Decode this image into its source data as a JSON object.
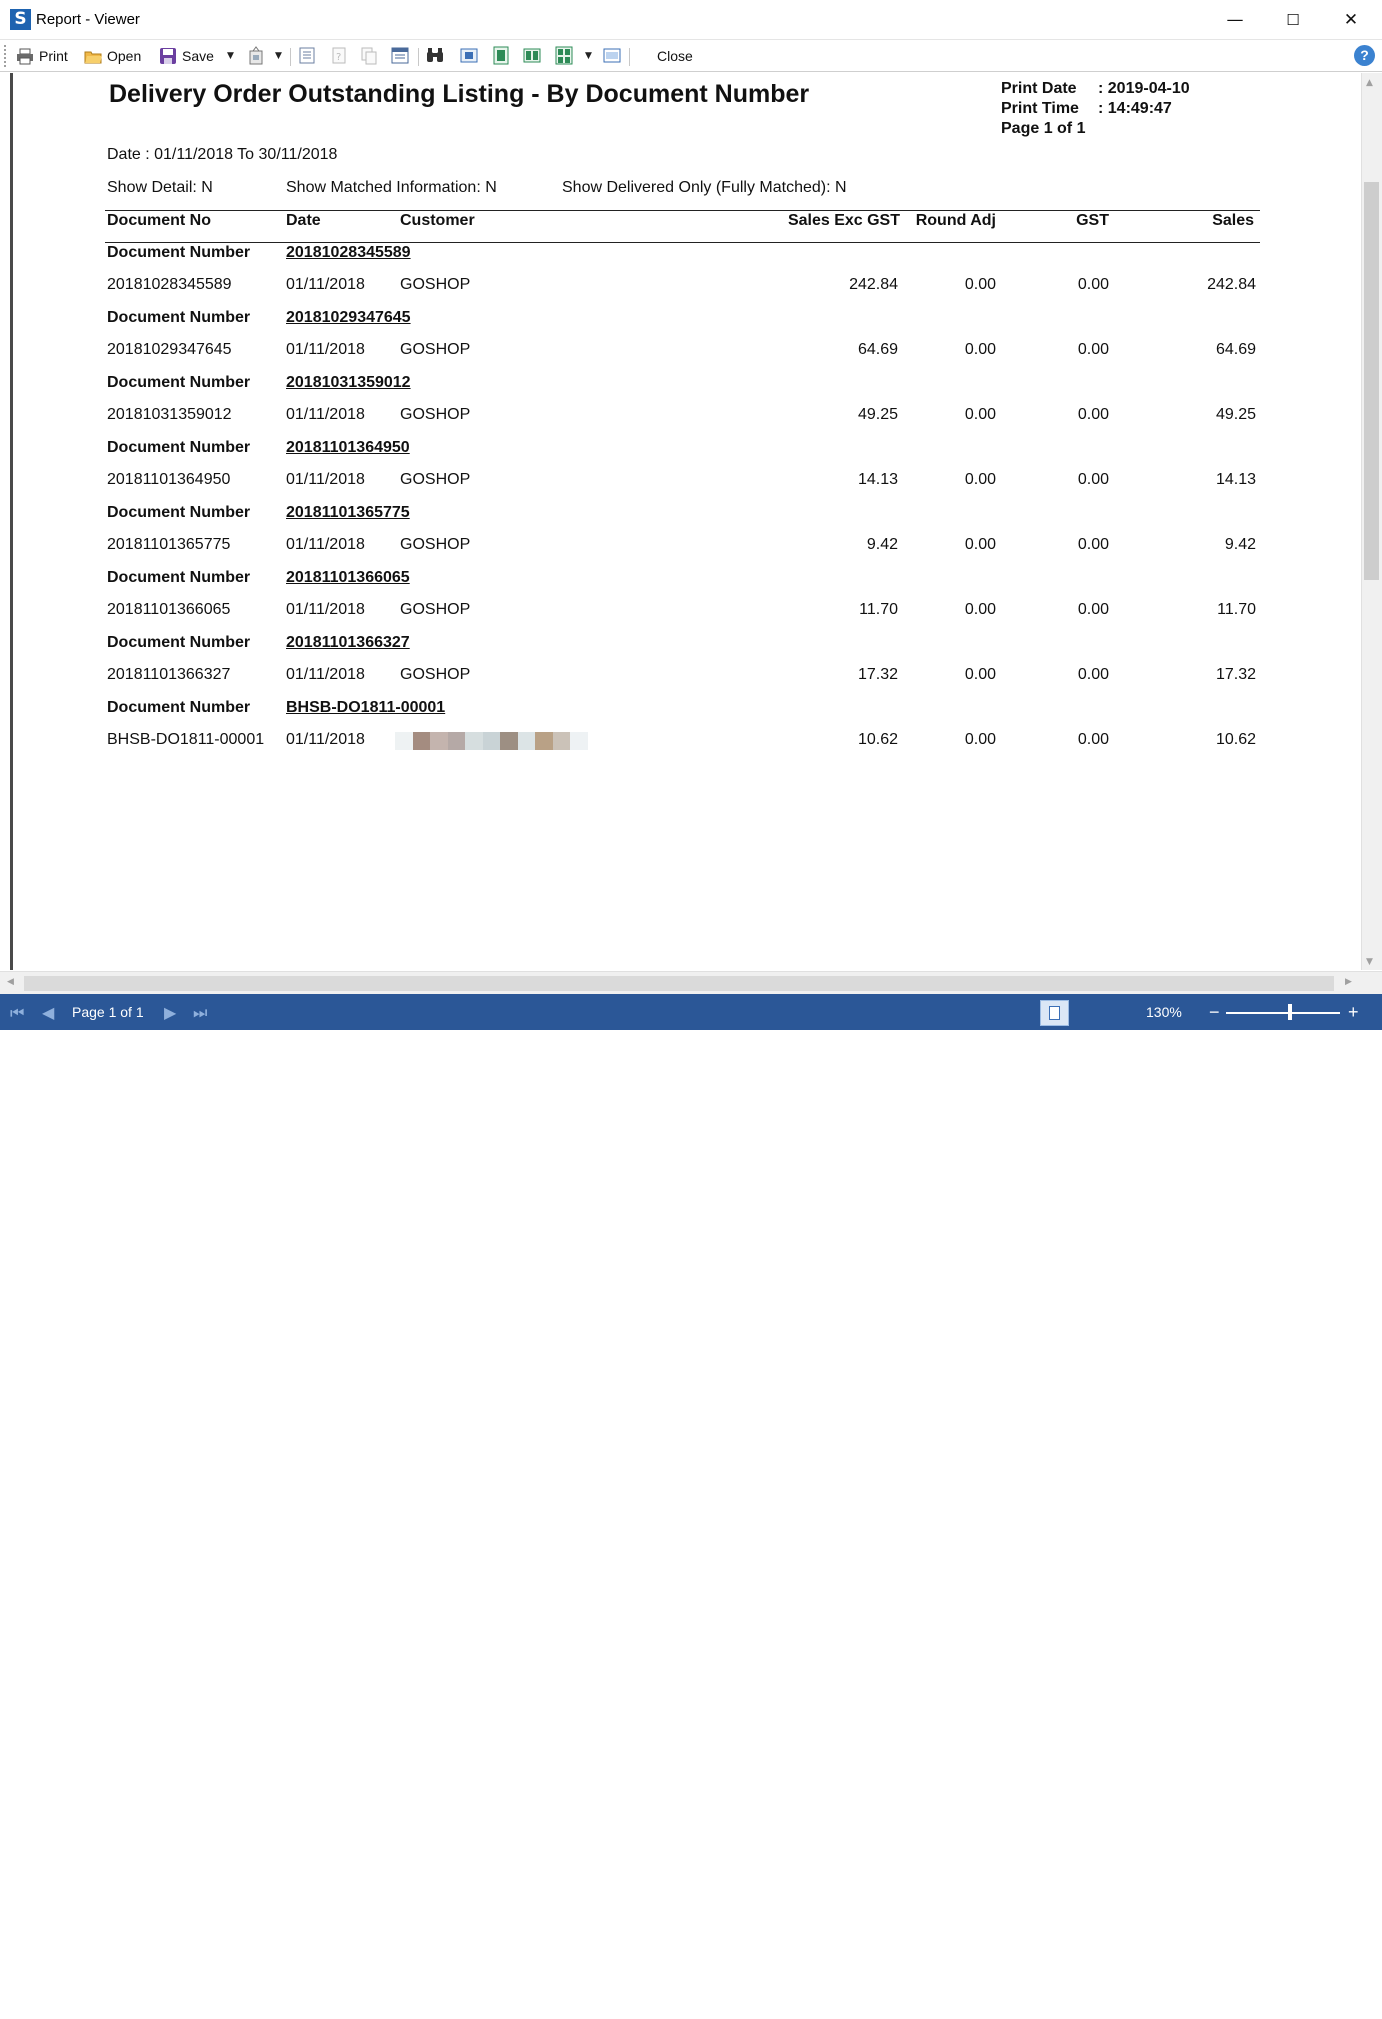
{
  "window": {
    "title": "Report - Viewer",
    "minimize": "—",
    "maximize": "☐",
    "close": "✕"
  },
  "toolbar": {
    "print_label": "Print",
    "open_label": "Open",
    "save_label": "Save",
    "close_label": "Close",
    "help_label": "?"
  },
  "report": {
    "title": "Delivery Order Outstanding Listing - By Document Number",
    "print_date_label": "Print Date",
    "print_date": ": 2019-04-10",
    "print_time_label": "Print Time",
    "print_time": ": 14:49:47",
    "page_info": "Page 1 of 1",
    "date_range": "Date : 01/11/2018 To 30/11/2018",
    "show_detail": "Show Detail: N",
    "show_matched": "Show Matched Information: N",
    "show_delivered": "Show Delivered Only (Fully Matched): N",
    "columns": {
      "doc_no": "Document No",
      "date": "Date",
      "customer": "Customer",
      "sales_exc_gst": "Sales Exc GST",
      "round_adj": "Round Adj",
      "gst": "GST",
      "sales": "Sales"
    },
    "group_label": "Document Number",
    "rows": [
      {
        "group": "20181028345589",
        "doc_no": "20181028345589",
        "date": "01/11/2018",
        "customer": "GOSHOP",
        "sales_exc_gst": "242.84",
        "round_adj": "0.00",
        "gst": "0.00",
        "sales": "242.84"
      },
      {
        "group": "20181029347645",
        "doc_no": "20181029347645",
        "date": "01/11/2018",
        "customer": "GOSHOP",
        "sales_exc_gst": "64.69",
        "round_adj": "0.00",
        "gst": "0.00",
        "sales": "64.69"
      },
      {
        "group": "20181031359012",
        "doc_no": "20181031359012",
        "date": "01/11/2018",
        "customer": "GOSHOP",
        "sales_exc_gst": "49.25",
        "round_adj": "0.00",
        "gst": "0.00",
        "sales": "49.25"
      },
      {
        "group": "20181101364950",
        "doc_no": "20181101364950",
        "date": "01/11/2018",
        "customer": "GOSHOP",
        "sales_exc_gst": "14.13",
        "round_adj": "0.00",
        "gst": "0.00",
        "sales": "14.13"
      },
      {
        "group": "20181101365775",
        "doc_no": "20181101365775",
        "date": "01/11/2018",
        "customer": "GOSHOP",
        "sales_exc_gst": "9.42",
        "round_adj": "0.00",
        "gst": "0.00",
        "sales": "9.42"
      },
      {
        "group": "20181101366065",
        "doc_no": "20181101366065",
        "date": "01/11/2018",
        "customer": "GOSHOP",
        "sales_exc_gst": "11.70",
        "round_adj": "0.00",
        "gst": "0.00",
        "sales": "11.70"
      },
      {
        "group": "20181101366327",
        "doc_no": "20181101366327",
        "date": "01/11/2018",
        "customer": "GOSHOP",
        "sales_exc_gst": "17.32",
        "round_adj": "0.00",
        "gst": "0.00",
        "sales": "17.32"
      },
      {
        "group": "BHSB-DO1811-00001",
        "doc_no": "BHSB-DO1811-00001",
        "date": "01/11/2018",
        "customer": "",
        "sales_exc_gst": "10.62",
        "round_adj": "0.00",
        "gst": "0.00",
        "sales": "10.62"
      }
    ]
  },
  "statusbar": {
    "page_label": "Page 1 of 1",
    "zoom": "130%",
    "zoom_out": "−",
    "zoom_in": "+"
  },
  "colors": {
    "statusbar_bg": "#2b5797",
    "accent": "#1e63b0"
  },
  "icons": [
    "app-logo-icon",
    "print-icon",
    "open-folder-icon",
    "save-disk-icon",
    "export-icon",
    "find-binoculars-icon",
    "help-icon",
    "first-page-icon",
    "prev-page-icon",
    "next-page-icon",
    "last-page-icon"
  ]
}
